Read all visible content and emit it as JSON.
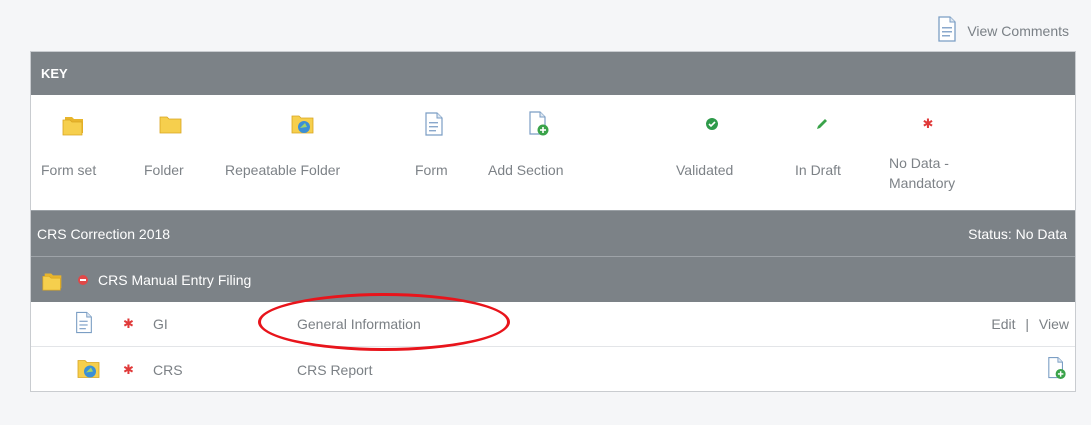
{
  "header": {
    "view_comments_label": "View Comments"
  },
  "key": {
    "title": "KEY",
    "items": [
      {
        "label": "Form set",
        "icon": "form-set-icon"
      },
      {
        "label": "Folder",
        "icon": "folder-icon"
      },
      {
        "label": "Repeatable Folder",
        "icon": "repeatable-folder-icon"
      },
      {
        "label": "Form",
        "icon": "form-icon"
      },
      {
        "label": "Add Section",
        "icon": "add-section-icon"
      },
      {
        "label": "Validated",
        "icon": "validated-icon"
      },
      {
        "label": "In Draft",
        "icon": "in-draft-icon"
      },
      {
        "label": "No Data - Mandatory",
        "icon": "no-data-mandatory-icon"
      }
    ]
  },
  "filing": {
    "title": "CRS Correction 2018",
    "status": "Status: No Data",
    "folder_title": "CRS Manual Entry Filing",
    "rows": [
      {
        "code": "GI",
        "name": "General Information",
        "edit": "Edit",
        "sep": "|",
        "view": "View",
        "icon": "form-icon"
      },
      {
        "code": "CRS",
        "name": "CRS Report",
        "icon": "repeatable-folder-icon",
        "action_icon": "add-section-icon"
      }
    ]
  },
  "colors": {
    "bar": "#7c8287",
    "star": "#e03a3a",
    "highlight": "#e8141b",
    "validated": "#2e9a4a"
  }
}
